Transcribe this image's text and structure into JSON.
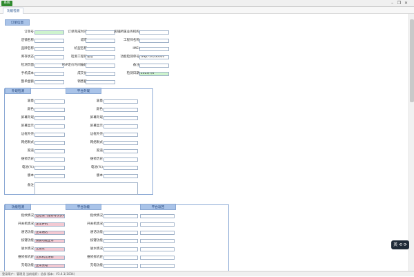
{
  "app": {
    "button": "系统",
    "tab": "功能检测"
  },
  "colors": {
    "section_header": "#a9c3e8",
    "green_field": "#cdf3cd",
    "pink_field": "#f3c9d2",
    "app_button": "#2f8a2f"
  },
  "order": {
    "section": "订单信息",
    "rows": [
      [
        {
          "label": "订单号",
          "value": "",
          "style": "green"
        },
        {
          "label": "订单完成时间",
          "value": ""
        },
        {
          "label": "店铺所属业务机构",
          "value": ""
        }
      ],
      [
        {
          "label": "店铺名称",
          "value": ""
        },
        {
          "label": "城市",
          "value": ""
        },
        {
          "label": "工程师名称",
          "value": ""
        }
      ],
      [
        {
          "label": "品牌名称",
          "value": ""
        },
        {
          "label": "机型名称",
          "value": ""
        },
        {
          "label": "IMEI",
          "value": ""
        }
      ],
      [
        {
          "label": "库存状态",
          "value": ""
        },
        {
          "label": "检测工程师",
          "value": "管理"
        },
        {
          "label": "功能检测单号",
          "value": "GNJC-20230603"
        }
      ],
      [
        {
          "label": "检测页面",
          "value": ""
        },
        {
          "label": "PSP定价时间编码",
          "value": ""
        },
        {
          "label": "备注",
          "value": ""
        }
      ],
      [
        {
          "label": "手机成本",
          "value": ""
        },
        {
          "label": "成交价",
          "value": ""
        },
        {
          "label": "检测日期",
          "value": "2023/7/6",
          "style": "green"
        }
      ],
      [
        {
          "label": "整单金额",
          "value": ""
        },
        {
          "label": "销售额",
          "value": ""
        }
      ]
    ]
  },
  "appearance": {
    "left_header": "外观检测",
    "right_header": "平台外观",
    "rows": [
      {
        "label": "容量",
        "left": "",
        "right": ""
      },
      {
        "label": "颜色",
        "left": "",
        "right": ""
      },
      {
        "label": "屏幕外观",
        "left": "",
        "right": ""
      },
      {
        "label": "屏幕显示",
        "left": "",
        "right": ""
      },
      {
        "label": "边框外壳",
        "left": "",
        "right": ""
      },
      {
        "label": "网络制式",
        "left": "",
        "right": ""
      },
      {
        "label": "渠道",
        "left": "",
        "right": ""
      },
      {
        "label": "维修历史",
        "left": "",
        "right": ""
      },
      {
        "label": "电池(%)",
        "left": "",
        "right": ""
      },
      {
        "label": "版本",
        "left": "",
        "right": ""
      }
    ],
    "remark_label": "备注",
    "remark_value": ""
  },
  "function": {
    "left_header": "功能检测",
    "middle_header": "平台功能",
    "right_header": "平台返回",
    "rows": [
      {
        "label": "指纹情况",
        "left": "已过保（维修等于买1月）",
        "right": ""
      },
      {
        "label": "开关机情况",
        "left": "正常开机",
        "right": ""
      },
      {
        "label": "通话功能",
        "left": "正常通话",
        "right": ""
      },
      {
        "label": "按键功能",
        "left": "按键功能正常",
        "right": ""
      },
      {
        "label": "进水情况",
        "left": "无进水",
        "right": ""
      },
      {
        "label": "维修拆机史",
        "left": "无拆机无维修",
        "right": ""
      },
      {
        "label": "充电功能",
        "left": "正常充电",
        "right": ""
      }
    ]
  },
  "status": {
    "text": "登录用户：管理员  当前组织：总部  版本：V3.4.1(1034)"
  },
  "float_tool": {
    "label": "英 ⟲ ⟳"
  }
}
